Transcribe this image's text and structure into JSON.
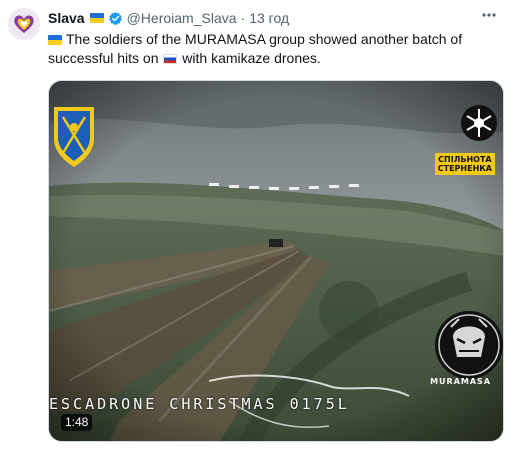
{
  "author": {
    "display_name": "Slava",
    "handle": "@Heroiam_Slava",
    "separator": "·",
    "time": "13 год",
    "avatar_icon": "heart-logo-icon",
    "verified_icon": "verified-badge-icon",
    "flag_icon": "ukraine-flag-icon"
  },
  "menu": {
    "more_icon": "more-options-icon"
  },
  "tweet": {
    "text_part1": "The soldiers of the MURAMASA group showed another batch of successful hits on",
    "text_part2": "with kamikaze drones.",
    "lead_flag_icon": "ukraine-flag-icon",
    "inline_flag_icon": "russia-flag-icon"
  },
  "media": {
    "duration": "1:48",
    "brand_label_line1": "СПІЛЬНОТА",
    "brand_label_line2": "СТЕРНЕНКА",
    "watermark_text": "MURAMASA",
    "osd_text": "ESCADRONE  CHRISTMAS  0175L",
    "colors": {
      "accent_yellow": "#f2c81a",
      "shield_blue": "#1d5fb8",
      "sky": "#8c9396",
      "field": "#4b5a43"
    }
  }
}
